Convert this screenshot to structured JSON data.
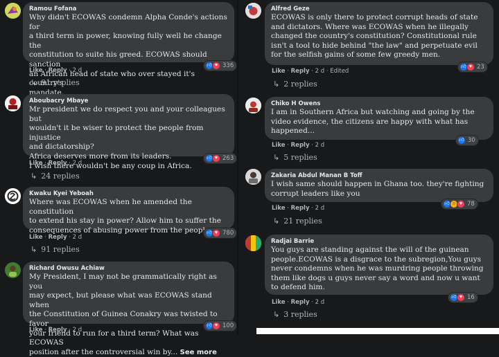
{
  "colors": {
    "background": "#18191a",
    "bubble": "#3a3b3c",
    "like": "#1877f2",
    "love": "#f33e58",
    "haha": "#f7b125"
  },
  "left_comments": [
    {
      "author": "Ramou Fofana",
      "text": "Why didn't ECOWAS condemn Alpha Conde's actions for\na third term in power, knowing fully well he change the\nconstitution to suite his greed. ECOWAS should sanction\nan African head of state who over stayed it's country's\nmandate.",
      "like": "Like",
      "reply": "Reply",
      "age": "2 d",
      "reactions": "336",
      "replies": "91 replies"
    },
    {
      "author": "Aboubacry Mbaye",
      "text": "Mr president we do respect you and your colleagues but\nwouldn't it be wiser to protect the people from injustice\nand dictatorship?\nAfrica deserves more from its leaders.\nI wish there wouldn't be any coup in Africa.",
      "like": "Like",
      "reply": "Reply",
      "age": "2 d",
      "reactions": "263",
      "replies": "24 replies"
    },
    {
      "author": "Kwaku Kyei Yeboah",
      "text": "Where was ECOWAS when he amended the constitution\nto extend his stay in power? Allow him to suffer the\nconsequences of abusing power from the people",
      "like": "Like",
      "reply": "Reply",
      "age": "2 d",
      "reactions": "780",
      "replies": "91 replies"
    },
    {
      "author": "Richard Owusu Achiaw",
      "text": "My President, I may not be grammatically right as you\nmay expect, but please what was ECOWAS stand when\nthe Constitution of Guinea Conakry was twisted to favor\nyour friend to run for a third term? What was ECOWAS\nposition after the controversial win by...",
      "see_more": "See more",
      "like": "Like",
      "reply": "Reply",
      "age": "2 d",
      "reactions": "100"
    }
  ],
  "right_comments": [
    {
      "author": "Alfred Geze",
      "text": "ECOWAS is only there to protect corrupt heads of state\nand dictators. Where was ECOWAS when he illegally\nchanged the country's constitution? Constitutional rule\nisn't a tool to hide behind \"the law\" and perpetuate evil\nfor the selfish gains of some few greedy men.",
      "like": "Like",
      "reply": "Reply",
      "age": "2 d",
      "edited": "Edited",
      "reactions": "23",
      "replies": "2 replies"
    },
    {
      "author": "Chiko H Owens",
      "text": "I am in Southern Africa but watching and going by the\nvideo evidence, the citizens are happy with what has\nhappened...",
      "like": "Like",
      "reply": "Reply",
      "age": "2 d",
      "reactions": "30",
      "replies": "5 replies"
    },
    {
      "author": "Zakaria Abdul Manan B Toff",
      "text": "I wish same should happen in Ghana too. they're fighting\ncorrupt leaders like you",
      "like": "Like",
      "reply": "Reply",
      "age": "2 d",
      "reactions": "78",
      "replies": "21 replies"
    },
    {
      "author": "Radjai Barrie",
      "text": "You guys are standing against the will of the guinean\npeople.ECOWAS is a disgrace to the subregion,You guys\nnever condemns when he was murdring people throwing\nthem like dogs u guys never say a word and now u want\nto defend him.",
      "like": "Like",
      "reply": "Reply",
      "age": "2 d",
      "reactions": "16",
      "replies": "3 replies"
    }
  ]
}
